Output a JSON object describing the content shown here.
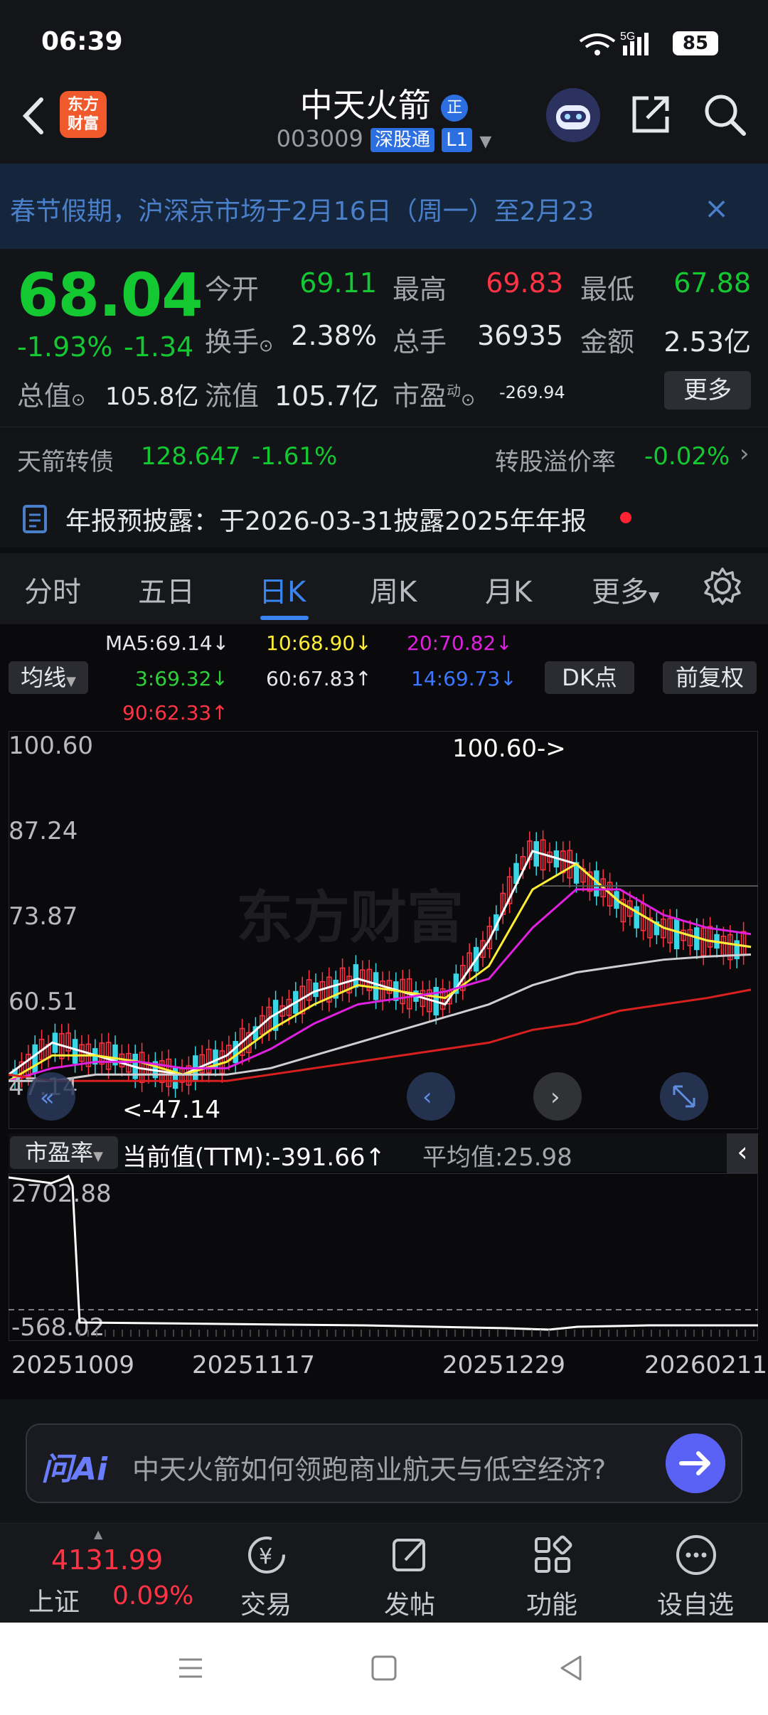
{
  "status": {
    "time": "06:39",
    "network": "5G",
    "battery": "85"
  },
  "header": {
    "logo_text": "东方财富",
    "title": "中天火箭",
    "title_badge": "正",
    "code": "003009",
    "market_tag": "深股通",
    "level_tag": "L1"
  },
  "notice": {
    "text": "春节假期，沪深京市场于2月16日（周一）至2月23",
    "close": "×"
  },
  "quote": {
    "price": "68.04",
    "change_pct": "-1.93%",
    "change_abs": "-1.34",
    "fields": [
      {
        "label": "今开",
        "value": "69.11",
        "color": "#14c832"
      },
      {
        "label": "最高",
        "value": "69.83",
        "color": "#ff3344"
      },
      {
        "label": "最低",
        "value": "67.88",
        "color": "#14c832"
      },
      {
        "label": "换手",
        "value": "2.38%",
        "color": "#e6e7ea"
      },
      {
        "label": "总手",
        "value": "36935",
        "color": "#e6e7ea"
      },
      {
        "label": "金额",
        "value": "2.53亿",
        "color": "#e6e7ea"
      }
    ],
    "total_mv_label": "总值",
    "total_mv": "105.8亿",
    "float_mv_label": "流值",
    "float_mv": "105.7亿",
    "pe_label": "市盈",
    "pe_sup": "动",
    "pe_value": "-269.94",
    "more": "更多"
  },
  "convertible": {
    "name": "天箭转债",
    "price": "128.647",
    "change": "-1.61%",
    "premium_label": "转股溢价率",
    "premium": "-0.02%"
  },
  "report": {
    "text": "年报预披露：于2026-03-31披露2025年年报"
  },
  "tabs": [
    "分时",
    "五日",
    "日K",
    "周K",
    "月K",
    "更多"
  ],
  "ma_legend": {
    "ma5": "MA5:69.14↓",
    "ma10": "10:68.90↓",
    "ma20": "20:70.82↓",
    "ma3": "3:69.32↓",
    "ma60": "60:67.83↑",
    "ma14": "14:69.73↓",
    "ma90": "90:62.33↑"
  },
  "chart_controls": {
    "ma_select": "均线",
    "dk": "DK点",
    "adjust": "前复权"
  },
  "chart_data": {
    "type": "line",
    "y_axis": [
      "100.60",
      "87.24",
      "73.87",
      "60.51",
      "47.14"
    ],
    "ylim": [
      47.14,
      100.6
    ],
    "high_label": "100.60->",
    "low_label": "<-47.14",
    "x": [
      "20251009",
      "20251117",
      "20251229",
      "20260211"
    ],
    "series": [
      {
        "name": "MA5",
        "color": "#ffffff",
        "values": [
          49,
          54,
          52,
          50,
          49,
          52,
          58,
          62,
          64,
          62,
          60,
          70,
          84,
          82,
          76,
          72,
          70,
          69
        ]
      },
      {
        "name": "MA10",
        "color": "#ffee33",
        "values": [
          48,
          52,
          52,
          51,
          49,
          51,
          56,
          60,
          63,
          62,
          61,
          66,
          78,
          82,
          76,
          72,
          70,
          69
        ]
      },
      {
        "name": "MA20",
        "color": "#e020e0",
        "values": [
          48,
          50,
          51,
          51,
          50,
          50,
          53,
          57,
          60,
          61,
          62,
          64,
          72,
          78,
          78,
          74,
          72,
          71
        ]
      },
      {
        "name": "MA60",
        "color": "#cfcfd3",
        "values": [
          48,
          48,
          49,
          49,
          49,
          49,
          50,
          52,
          54,
          56,
          58,
          60,
          63,
          65,
          66,
          67,
          67.5,
          67.8
        ]
      },
      {
        "name": "MA90",
        "color": "#d82020",
        "values": [
          49,
          48,
          48,
          48,
          48,
          48,
          49,
          50,
          51,
          52,
          53,
          54,
          56,
          57,
          59,
          60,
          61,
          62.3
        ]
      }
    ],
    "pe": {
      "label": "市盈率",
      "current": "当前值(TTM):-391.66↑",
      "average": "平均值:25.98",
      "y_axis": [
        "2702.88",
        "-568.02"
      ]
    }
  },
  "ask_ai": {
    "logo": "问Ai",
    "prompt": "中天火箭如何领跑商业航天与低空经济?"
  },
  "bottom_nav": {
    "index_value": "4131.99",
    "index_name": "上证",
    "index_change": "0.09%",
    "items": [
      "交易",
      "发帖",
      "功能",
      "设自选"
    ]
  }
}
